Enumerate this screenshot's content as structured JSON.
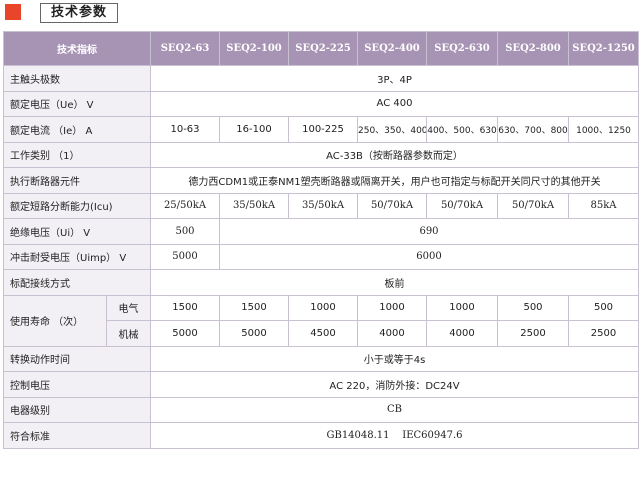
{
  "header": {
    "title": "技术参数"
  },
  "columns": [
    "技术指标",
    "SEQ2-63",
    "SEQ2-100",
    "SEQ2-225",
    "SEQ2-400",
    "SEQ2-630",
    "SEQ2-800",
    "SEQ2-1250"
  ],
  "rows": {
    "poles": {
      "label": "主触头极数",
      "value": "3P、4P"
    },
    "ue": {
      "label": "额定电压（Ue） V",
      "value": "AC 400"
    },
    "ie": {
      "label": "额定电流 （Ie） A",
      "values": [
        "10-63",
        "16-100",
        "100-225",
        "250、350、400",
        "400、500、630",
        "630、700、800",
        "1000、1250"
      ]
    },
    "category": {
      "label": "工作类别 （1）",
      "value": "AC-33B（按断路器参数而定）"
    },
    "breaker": {
      "label": "执行断路器元件",
      "value": "德力西CDM1或正泰NM1塑壳断路器或隔离开关，用户也可指定与标配开关同尺寸的其他开关"
    },
    "icu": {
      "label": "额定短路分断能力(Icu)",
      "values": [
        "25/50kA",
        "35/50kA",
        "35/50kA",
        "50/70kA",
        "50/70kA",
        "50/70kA",
        "85kA"
      ]
    },
    "ui": {
      "label": "绝缘电压（Ui） V",
      "first": "500",
      "rest": "690"
    },
    "uimp": {
      "label": "冲击耐受电压（Uimp） V",
      "first": "5000",
      "rest": "6000"
    },
    "wiring": {
      "label": "标配接线方式",
      "value": "板前"
    },
    "life": {
      "label": "使用寿命 （次）",
      "electrical": {
        "label": "电气",
        "values": [
          "1500",
          "1500",
          "1000",
          "1000",
          "1000",
          "500",
          "500"
        ]
      },
      "mechanical": {
        "label": "机械",
        "values": [
          "5000",
          "5000",
          "4500",
          "4000",
          "4000",
          "2500",
          "2500"
        ]
      }
    },
    "switch_time": {
      "label": "转换动作时间",
      "value": "小于或等于4s"
    },
    "control": {
      "label": "控制电压",
      "value": "AC 220，消防外接：DC24V"
    },
    "level": {
      "label": "电器级别",
      "value": "CB"
    },
    "standard": {
      "label": "符合标准",
      "value": "GB14048.11    IEC60947.6"
    }
  }
}
